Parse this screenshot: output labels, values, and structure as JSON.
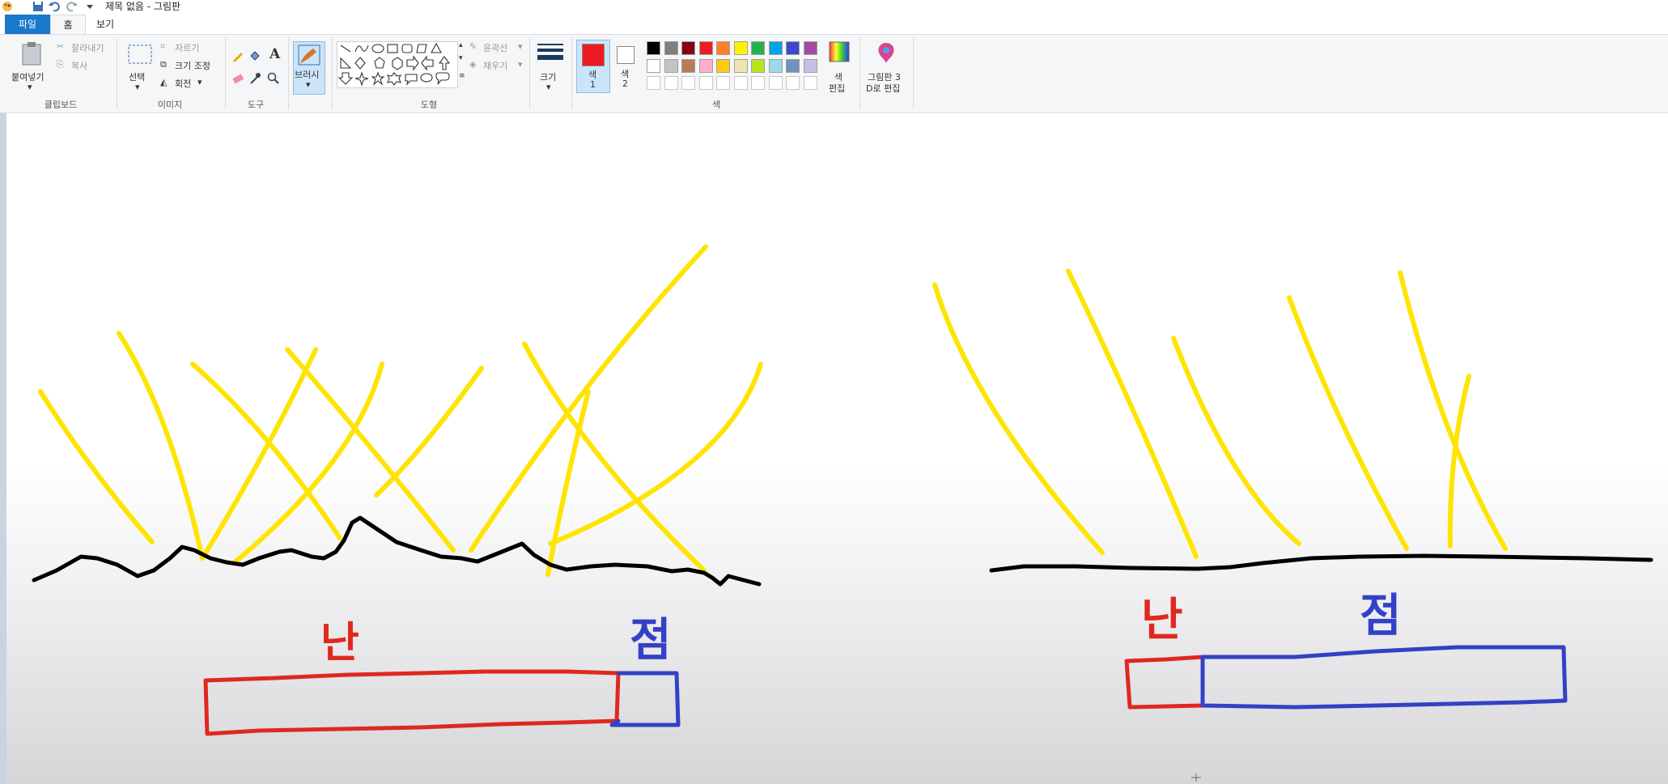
{
  "window": {
    "title": "제목 없음 - 그림판"
  },
  "tabs": {
    "file": "파일",
    "home": "홈",
    "view": "보기"
  },
  "clipboard": {
    "paste": "붙여넣기",
    "cut": "잘라내기",
    "copy": "복사",
    "label": "클립보드"
  },
  "image": {
    "select": "선택",
    "crop": "자르기",
    "resize": "크기 조정",
    "rotate": "회전",
    "label": "이미지"
  },
  "tools": {
    "label": "도구"
  },
  "brush": {
    "label": "브러시"
  },
  "shapes": {
    "outline": "윤곽선",
    "fill": "채우기",
    "label": "도형"
  },
  "size": {
    "label": "크기"
  },
  "colors": {
    "color1_a": "색",
    "color1_b": "1",
    "color2_a": "색",
    "color2_b": "2",
    "edit_a": "색",
    "edit_b": "편집",
    "label": "색",
    "color1_value": "#ed1c24",
    "color2_value": "#ffffff",
    "palette_row1": [
      "#000000",
      "#7f7f7f",
      "#880015",
      "#ed1c24",
      "#ff7f27",
      "#fff200",
      "#22b14c",
      "#00a2e8",
      "#3f48cc",
      "#a349a4"
    ],
    "palette_row2": [
      "#ffffff",
      "#c3c3c3",
      "#b97a57",
      "#ffaec9",
      "#ffc90e",
      "#efe4b0",
      "#b5e61d",
      "#99d9ea",
      "#7092be",
      "#c8bfe7"
    ]
  },
  "paint3d": {
    "line1": "그림판 3",
    "line2": "D로 편집"
  },
  "drawing": {
    "left_red_label": "난",
    "left_blue_label": "점",
    "right_red_label": "난",
    "right_blue_label": "점",
    "stroke_yellow": "#ffe400",
    "stroke_black": "#000000",
    "stroke_red": "#e0281e",
    "stroke_blue": "#3241c6"
  }
}
